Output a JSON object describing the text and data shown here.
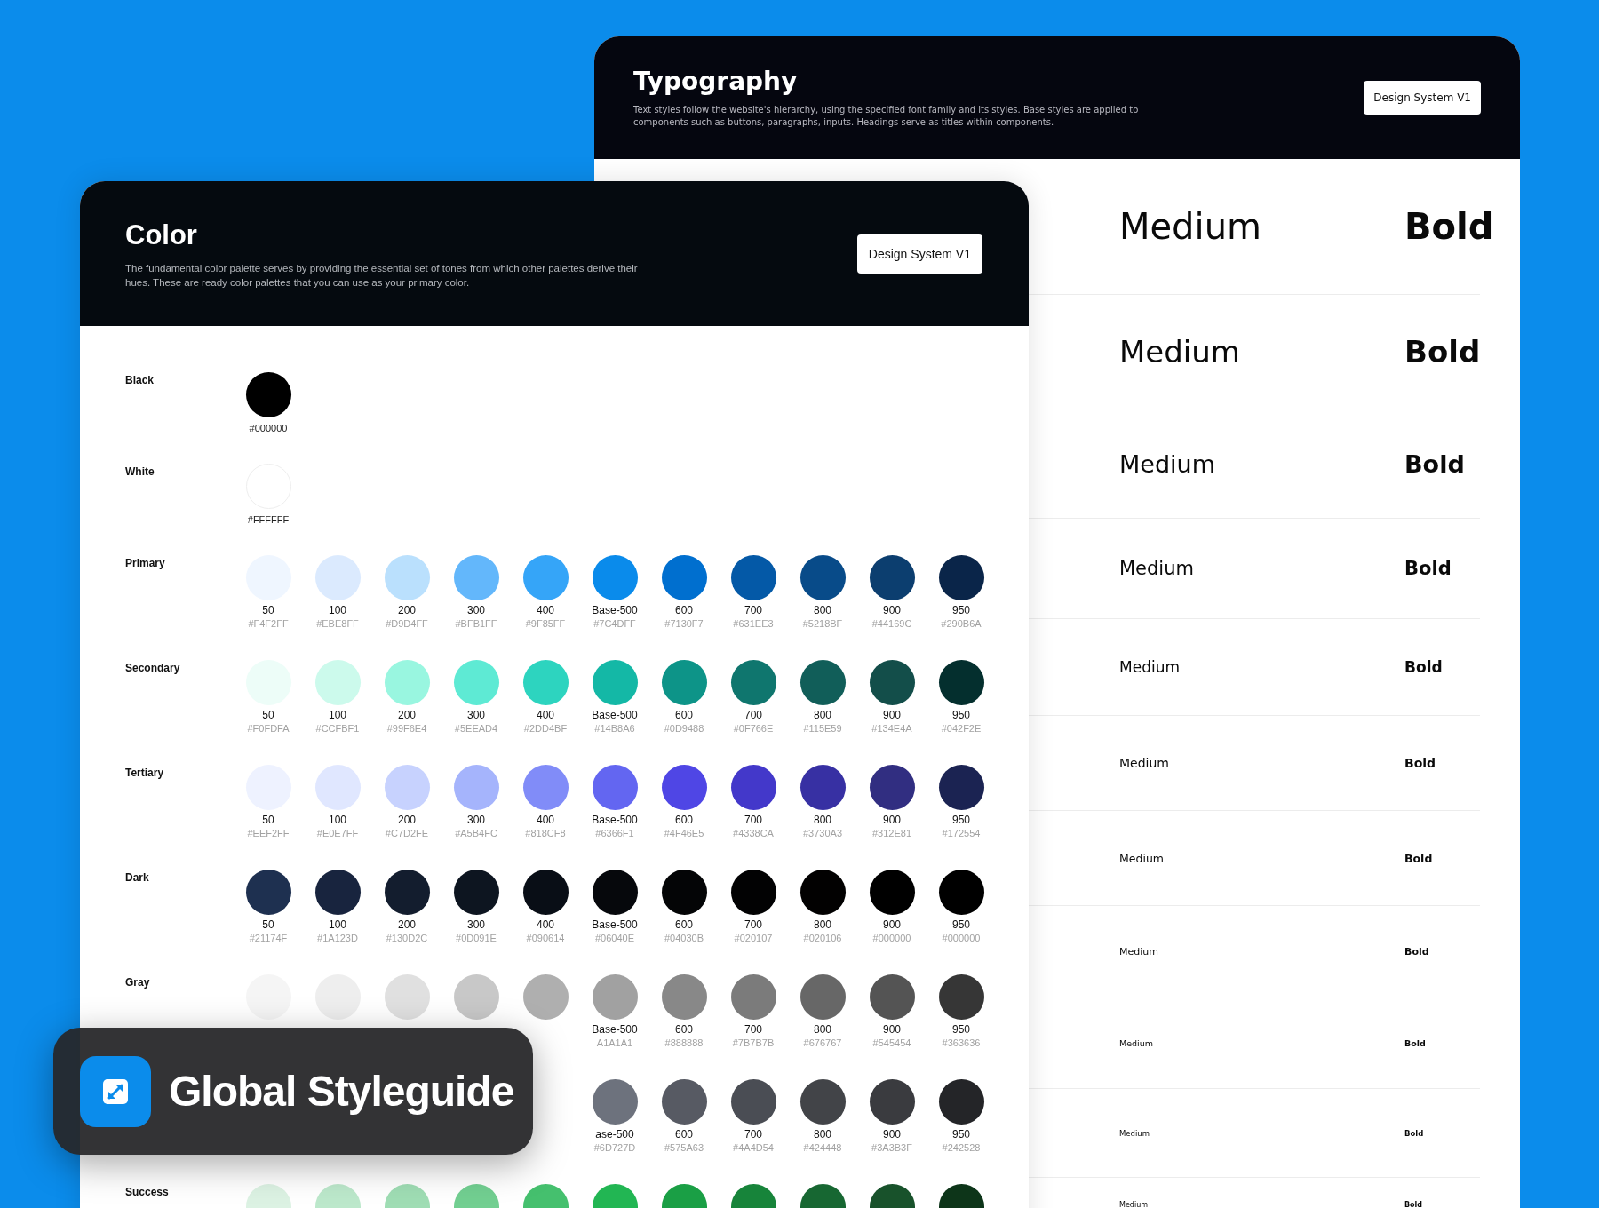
{
  "typography": {
    "title": "Typography",
    "description": "Text styles follow the website's hierarchy, using the specified font family and its styles. Base styles are applied to components such as buttons, paragraphs, inputs. Headings serve as titles within components.",
    "button": "Design System V1",
    "rows": [
      {
        "medium": "Medium",
        "bold": "Bold"
      },
      {
        "medium": "Medium",
        "bold": "Bold"
      },
      {
        "medium": "Medium",
        "bold": "Bold"
      },
      {
        "medium": "Medium",
        "bold": "Bold"
      },
      {
        "medium": "Medium",
        "bold": "Bold"
      },
      {
        "medium": "Medium",
        "bold": "Bold"
      },
      {
        "medium": "Medium",
        "bold": "Bold"
      },
      {
        "medium": "Medium",
        "bold": "Bold"
      },
      {
        "medium": "Medium",
        "bold": "Bold"
      },
      {
        "medium": "Medium",
        "bold": "Bold"
      },
      {
        "medium": "Medium",
        "bold": "Bold"
      }
    ]
  },
  "color": {
    "title": "Color",
    "description": "The fundamental color palette serves by providing the essential set of tones from which other palettes derive their hues. These are ready color palettes that you can use as your primary color.",
    "button": "Design System V1",
    "rows": [
      {
        "name": "Black",
        "swatches": [
          {
            "color": "#000000",
            "hex": "#000000"
          }
        ]
      },
      {
        "name": "White",
        "swatches": [
          {
            "color": "#ffffff",
            "hex": "#FFFFFF"
          }
        ]
      },
      {
        "name": "Primary",
        "swatches": [
          {
            "color": "#eff6ff",
            "label": "50",
            "hex": "#F4F2FF"
          },
          {
            "color": "#dbeafe",
            "label": "100",
            "hex": "#EBE8FF"
          },
          {
            "color": "#bae0fd",
            "label": "200",
            "hex": "#D9D4FF"
          },
          {
            "color": "#63b7fb",
            "label": "300",
            "hex": "#BFB1FF"
          },
          {
            "color": "#35a5f8",
            "label": "400",
            "hex": "#9F85FF"
          },
          {
            "color": "#0a8beb",
            "label": "Base-500",
            "hex": "#7C4DFF"
          },
          {
            "color": "#006fcf",
            "label": "600",
            "hex": "#7130F7"
          },
          {
            "color": "#0459a7",
            "label": "700",
            "hex": "#631EE3"
          },
          {
            "color": "#084b89",
            "label": "800",
            "hex": "#5218BF"
          },
          {
            "color": "#0c3e6f",
            "label": "900",
            "hex": "#44169C"
          },
          {
            "color": "#0a2549",
            "label": "950",
            "hex": "#290B6A"
          }
        ]
      },
      {
        "name": "Secondary",
        "swatches": [
          {
            "color": "#edfdf8",
            "label": "50",
            "hex": "#F0FDFA"
          },
          {
            "color": "#ccfaec",
            "label": "100",
            "hex": "#CCFBF1"
          },
          {
            "color": "#99f6e0",
            "label": "200",
            "hex": "#99F6E4"
          },
          {
            "color": "#5eead4",
            "label": "300",
            "hex": "#5EEAD4"
          },
          {
            "color": "#2dd4bf",
            "label": "400",
            "hex": "#2DD4BF"
          },
          {
            "color": "#14b8a6",
            "label": "Base-500",
            "hex": "#14B8A6"
          },
          {
            "color": "#0d9488",
            "label": "600",
            "hex": "#0D9488"
          },
          {
            "color": "#0f766e",
            "label": "700",
            "hex": "#0F766E"
          },
          {
            "color": "#115e59",
            "label": "800",
            "hex": "#115E59"
          },
          {
            "color": "#134e4a",
            "label": "900",
            "hex": "#134E4A"
          },
          {
            "color": "#042f2e",
            "label": "950",
            "hex": "#042F2E"
          }
        ]
      },
      {
        "name": "Tertiary",
        "swatches": [
          {
            "color": "#eef2ff",
            "label": "50",
            "hex": "#EEF2FF"
          },
          {
            "color": "#e0e7ff",
            "label": "100",
            "hex": "#E0E7FF"
          },
          {
            "color": "#c7d2fe",
            "label": "200",
            "hex": "#C7D2FE"
          },
          {
            "color": "#a5b4fc",
            "label": "300",
            "hex": "#A5B4FC"
          },
          {
            "color": "#818cf8",
            "label": "400",
            "hex": "#818CF8"
          },
          {
            "color": "#6366f1",
            "label": "Base-500",
            "hex": "#6366F1"
          },
          {
            "color": "#4f46e5",
            "label": "600",
            "hex": "#4F46E5"
          },
          {
            "color": "#4338ca",
            "label": "700",
            "hex": "#4338CA"
          },
          {
            "color": "#3730a3",
            "label": "800",
            "hex": "#3730A3"
          },
          {
            "color": "#312e81",
            "label": "900",
            "hex": "#312E81"
          },
          {
            "color": "#1b2352",
            "label": "950",
            "hex": "#172554"
          }
        ]
      },
      {
        "name": "Dark",
        "swatches": [
          {
            "color": "#1e3050",
            "label": "50",
            "hex": "#21174F"
          },
          {
            "color": "#18243e",
            "label": "100",
            "hex": "#1A123D"
          },
          {
            "color": "#131d2e",
            "label": "200",
            "hex": "#130D2C"
          },
          {
            "color": "#0d1520",
            "label": "300",
            "hex": "#0D091E"
          },
          {
            "color": "#090e16",
            "label": "400",
            "hex": "#090614"
          },
          {
            "color": "#06080c",
            "label": "Base-500",
            "hex": "#06040E"
          },
          {
            "color": "#040506",
            "label": "600",
            "hex": "#04030B"
          },
          {
            "color": "#020203",
            "label": "700",
            "hex": "#020107"
          },
          {
            "color": "#020101",
            "label": "800",
            "hex": "#020106"
          },
          {
            "color": "#000000",
            "label": "900",
            "hex": "#000000"
          },
          {
            "color": "#000000",
            "label": "950",
            "hex": "#000000"
          }
        ]
      },
      {
        "name": "Gray",
        "swatches": [
          {
            "color": "#f5f5f5"
          },
          {
            "color": "#eeeeee"
          },
          {
            "color": "#e0e0e0"
          },
          {
            "color": "#c8c8c8"
          },
          {
            "color": "#afafaf"
          },
          {
            "color": "#a1a1a1",
            "label": "Base-500",
            "hex": "A1A1A1"
          },
          {
            "color": "#888888",
            "label": "600",
            "hex": "#888888"
          },
          {
            "color": "#7b7b7b",
            "label": "700",
            "hex": "#7B7B7B"
          },
          {
            "color": "#676767",
            "label": "800",
            "hex": "#676767"
          },
          {
            "color": "#545454",
            "label": "900",
            "hex": "#545454"
          },
          {
            "color": "#363636",
            "label": "950",
            "hex": "#363636"
          }
        ]
      },
      {
        "swatches": [
          {
            "color": "#6d727d",
            "label": "ase-500",
            "hex": "#6D727D"
          },
          {
            "color": "#575a63",
            "label": "600",
            "hex": "#575A63"
          },
          {
            "color": "#4a4d54",
            "label": "700",
            "hex": "#4A4D54"
          },
          {
            "color": "#424448",
            "label": "800",
            "hex": "#424448"
          },
          {
            "color": "#3a3b3f",
            "label": "900",
            "hex": "#3A3B3F"
          },
          {
            "color": "#242528",
            "label": "950",
            "hex": "#242528"
          }
        ]
      },
      {
        "name": "Success",
        "swatches": [
          {
            "color": "#dcf2e3"
          },
          {
            "color": "#bce8cb"
          },
          {
            "color": "#9fddb4"
          },
          {
            "color": "#72cf91"
          },
          {
            "color": "#45c06e"
          },
          {
            "color": "#22b653"
          },
          {
            "color": "#1a9f45"
          },
          {
            "color": "#17843a"
          },
          {
            "color": "#176732"
          },
          {
            "color": "#18522b"
          },
          {
            "color": "#0d3519"
          }
        ]
      }
    ]
  },
  "badge": {
    "title": "Global Styleguide"
  }
}
